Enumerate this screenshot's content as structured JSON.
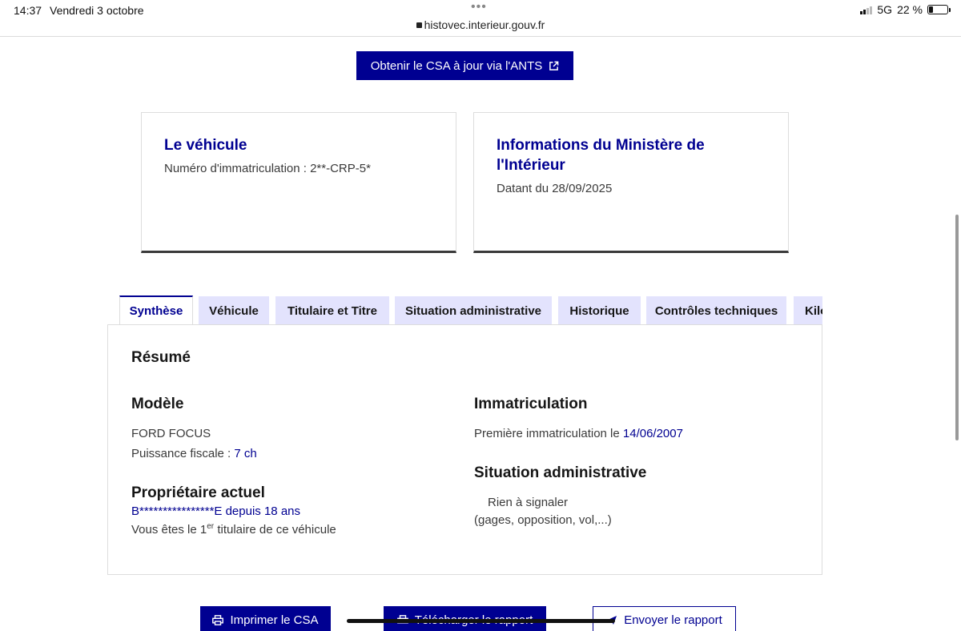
{
  "status_bar": {
    "time": "14:37",
    "date": "Vendredi 3 octobre",
    "url": "histovec.interieur.gouv.fr",
    "network": "5G",
    "battery": "22 %"
  },
  "ants_button": {
    "label": "Obtenir le CSA à jour via l'ANTS"
  },
  "cards": {
    "vehicle": {
      "title": "Le véhicule",
      "text": "Numéro d'immatriculation : 2**-CRP-5*"
    },
    "ministry": {
      "title": "Informations du Ministère de l'Intérieur",
      "text": "Datant du 28/09/2025"
    }
  },
  "tabs": [
    {
      "label": "Synthèse"
    },
    {
      "label": "Véhicule"
    },
    {
      "label": "Titulaire et Titre"
    },
    {
      "label": "Situation administrative"
    },
    {
      "label": "Historique"
    },
    {
      "label": "Contrôles techniques"
    },
    {
      "label": "Kilo"
    }
  ],
  "summary": {
    "title": "Résumé",
    "model": {
      "heading": "Modèle",
      "name": "FORD FOCUS",
      "power_label": "Puissance fiscale : ",
      "power_value": "7 ch"
    },
    "owner": {
      "heading": "Propriétaire actuel",
      "name": "B****************E",
      "since_label": " depuis ",
      "since_value": "18 ans",
      "rank_prefix": "Vous êtes le ",
      "rank_number": "1",
      "rank_sup": "er",
      "rank_suffix": " titulaire de ce véhicule"
    },
    "registration": {
      "heading": "Immatriculation",
      "label": "Première immatriculation le ",
      "date": "14/06/2007"
    },
    "admin": {
      "heading": "Situation administrative",
      "status": "Rien à signaler",
      "detail": "(gages, opposition, vol,...)"
    }
  },
  "actions": {
    "print": "Imprimer le CSA",
    "download": "Télécharger le rapport",
    "send": "Envoyer le rapport"
  }
}
